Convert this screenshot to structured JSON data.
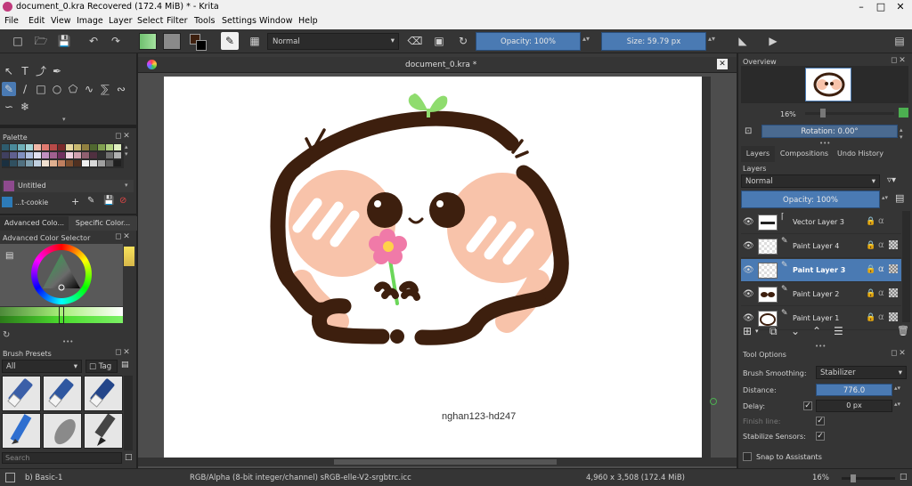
{
  "window": {
    "title": "document_0.kra Recovered  (172.4 MiB)  * - Krita",
    "controls": [
      "–",
      "□",
      "✕"
    ]
  },
  "menu": [
    "File",
    "Edit",
    "View",
    "Image",
    "Layer",
    "Select",
    "Filter",
    "Tools",
    "Settings",
    "Window",
    "Help"
  ],
  "toolbar": {
    "blend_mode": "Normal",
    "opacity": "Opacity: 100%",
    "size": "Size: 59.79 px"
  },
  "left_dock": {
    "palette_title": "Palette",
    "palette_name": "Untitled",
    "brush_tag_text": "...t-cookie",
    "color_tabs": [
      "Advanced Colo...",
      "Specific Color..."
    ],
    "color_selector_title": "Advanced Color Selector",
    "brush_presets_title": "Brush Presets",
    "brush_filter": "All",
    "tag_label": "Tag",
    "search_placeholder": "Search"
  },
  "document": {
    "tab_title": "document_0.kra *",
    "watermark": "nghan123-hd247"
  },
  "overview": {
    "title": "Overview",
    "zoom": "16%",
    "rotation": "Rotation: 0.00°"
  },
  "layers_dock": {
    "tabs": [
      "Layers",
      "Compositions",
      "Undo History"
    ],
    "title": "Layers",
    "blend_mode": "Normal",
    "opacity": "Opacity:  100%",
    "layers": [
      {
        "name": "Vector Layer 3",
        "selected": false
      },
      {
        "name": "Paint Layer 4",
        "selected": false
      },
      {
        "name": "Paint Layer 3",
        "selected": true
      },
      {
        "name": "Paint Layer 2",
        "selected": false
      },
      {
        "name": "Paint Layer 1",
        "selected": false
      }
    ]
  },
  "tool_options": {
    "title": "Tool Options",
    "smoothing_label": "Brush Smoothing:",
    "smoothing_value": "Stabilizer",
    "distance_label": "Distance:",
    "distance_value": "776.0",
    "delay_label": "Delay:",
    "delay_value": "0 px",
    "finish_line_label": "Finish line:",
    "stabilize_sensors_label": "Stabilize Sensors:",
    "snap_label": "Snap to Assistants"
  },
  "status": {
    "brush": "b) Basic-1",
    "color_space": "RGB/Alpha (8-bit integer/channel)  sRGB-elle-V2-srgbtrc.icc",
    "dimensions": "4,960 x 3,508 (172.4 MiB)",
    "zoom": "16%"
  },
  "colors": {
    "accent": "#4a7ab3",
    "outline": "#3d1f0e",
    "blush": "#f8c3aa",
    "leaf": "#8fdc6e",
    "flower": "#f07aa8"
  }
}
